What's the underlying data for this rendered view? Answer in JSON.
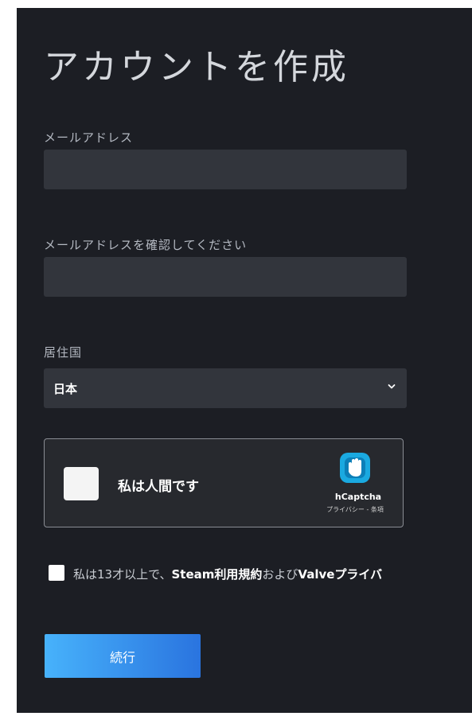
{
  "page": {
    "title": "アカウントを作成"
  },
  "form": {
    "email_label": "メールアドレス",
    "email_value": "",
    "confirm_email_label": "メールアドレスを確認してください",
    "confirm_email_value": "",
    "country_label": "居住国",
    "country_value": "日本"
  },
  "captcha": {
    "checkbox_label": "私は人間です",
    "brand": "hCaptcha",
    "links": "プライバシー - 条項",
    "checked": false
  },
  "agreement": {
    "prefix": "私は13才以上で、",
    "link1": "Steam利用規約",
    "middle": "および",
    "link2": "Valveプライバ",
    "checked": false
  },
  "buttons": {
    "continue_label": "続行"
  },
  "colors": {
    "panel_bg": "#1c1e24",
    "input_bg": "#32353c",
    "button_gradient_start": "#47b2fb",
    "button_gradient_end": "#2a74df",
    "hcaptcha_accent": "#1aa9e0"
  },
  "icons": {
    "select_chevron": "chevron-down-icon",
    "captcha_logo": "hcaptcha-hand-icon"
  }
}
